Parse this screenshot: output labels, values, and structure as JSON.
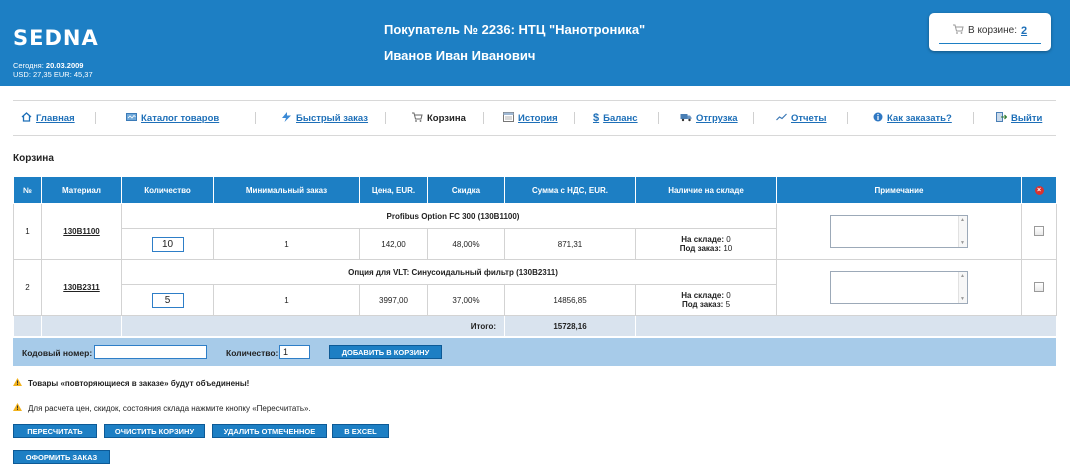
{
  "header": {
    "logo": "SEDNA",
    "date_label": "Сегодня:",
    "date_value": "20.03.2009",
    "rates": "USD: 27,35 EUR: 45,37",
    "buyer": "Покупатель № 2236: НТЦ \"Нанотроника\"",
    "person": "Иванов Иван Иванович",
    "cart_label": "В корзине:",
    "cart_count": "2"
  },
  "nav": {
    "items": [
      {
        "label": "Главная",
        "icon": "home-icon"
      },
      {
        "label": "Каталог товаров",
        "icon": "catalog-icon"
      },
      {
        "label": "Быстрый заказ",
        "icon": "lightning-icon"
      },
      {
        "label": "Корзина",
        "icon": "cart-icon"
      },
      {
        "label": "История",
        "icon": "history-icon"
      },
      {
        "label": "Баланс",
        "icon": "dollar-icon"
      },
      {
        "label": "Отгрузка",
        "icon": "truck-icon"
      },
      {
        "label": "Отчеты",
        "icon": "chart-icon"
      },
      {
        "label": "Как заказать?",
        "icon": "info-icon"
      },
      {
        "label": "Выйти",
        "icon": "exit-icon"
      }
    ]
  },
  "page": {
    "title": "Корзина"
  },
  "table": {
    "headers": [
      "№",
      "Материал",
      "Количество",
      "Минимальный заказ",
      "Цена, EUR.",
      "Скидка",
      "Сумма с НДС, EUR.",
      "Наличие на складе",
      "Примечание"
    ],
    "rows": [
      {
        "num": "1",
        "material": "130B1100",
        "name": "Profibus Option FC 300 (130B1100)",
        "qty": "10",
        "min_order": "1",
        "price": "142,00",
        "discount": "48,00%",
        "sum": "871,31",
        "stock_label": "На складе:",
        "stock_value": "0",
        "order_label": "Под заказ:",
        "order_value": "10"
      },
      {
        "num": "2",
        "material": "130B2311",
        "name": "Опция для VLT: Синусоидальный фильтр (130B2311)",
        "qty": "5",
        "min_order": "1",
        "price": "3997,00",
        "discount": "37,00%",
        "sum": "14856,85",
        "stock_label": "На складе:",
        "stock_value": "0",
        "order_label": "Под заказ:",
        "order_value": "5"
      }
    ],
    "total_label": "Итого:",
    "total_value": "15728,16"
  },
  "addbar": {
    "code_label": "Кодовый номер:",
    "code_value": "",
    "qty_label": "Количество:",
    "qty_value": "1",
    "add_button": "ДОБАВИТЬ В КОРЗИНУ"
  },
  "notices": {
    "merge": "Товары «повторяющиеся в заказе» будут объединены!",
    "recalc": "Для расчета цен, скидок, состояния склада нажмите кнопку «Пересчитать»."
  },
  "buttons": {
    "recalc": "ПЕРЕСЧИТАТЬ",
    "clear": "ОЧИСТИТЬ КОРЗИНУ",
    "delete": "УДАЛИТЬ ОТМЕЧЕННОЕ",
    "excel": "В EXCEL",
    "checkout": "ОФОРМИТЬ ЗАКАЗ"
  },
  "colors": {
    "brand": "#1d7fc4",
    "addbar": "#a7cbe9",
    "link": "#1d6fb8",
    "delete": "#d9322f"
  }
}
